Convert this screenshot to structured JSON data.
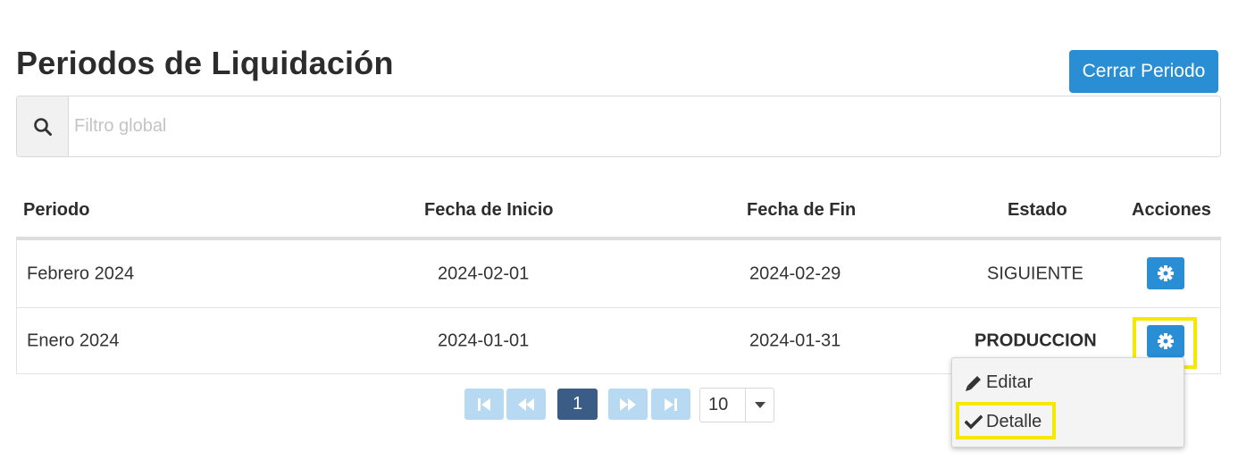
{
  "header": {
    "title": "Periodos de Liquidación",
    "close_period_label": "Cerrar Periodo"
  },
  "search": {
    "icon": "search-icon",
    "placeholder": "Filtro global",
    "value": ""
  },
  "table": {
    "columns": [
      "Periodo",
      "Fecha de Inicio",
      "Fecha de Fin",
      "Estado",
      "Acciones"
    ],
    "rows": [
      {
        "periodo": "Febrero 2024",
        "inicio": "2024-02-01",
        "fin": "2024-02-29",
        "estado": "SIGUIENTE",
        "estado_bold": false,
        "action_icon": "gear-icon"
      },
      {
        "periodo": "Enero 2024",
        "inicio": "2024-01-01",
        "fin": "2024-01-31",
        "estado": "PRODUCCION",
        "estado_bold": true,
        "action_icon": "gear-icon"
      }
    ]
  },
  "actions_menu": {
    "items": [
      {
        "label": "Editar",
        "icon": "pencil-icon"
      },
      {
        "label": "Detalle",
        "icon": "check-icon"
      }
    ]
  },
  "pagination": {
    "current_page": "1",
    "page_size": "10",
    "buttons": [
      "first-page-icon",
      "prev-page-icon",
      "next-page-icon",
      "last-page-icon"
    ]
  },
  "colors": {
    "primary": "#2a8ed4",
    "pager_disabled": "#b7d9f1",
    "pager_active": "#3b5d85",
    "highlight": "#f5e900"
  }
}
